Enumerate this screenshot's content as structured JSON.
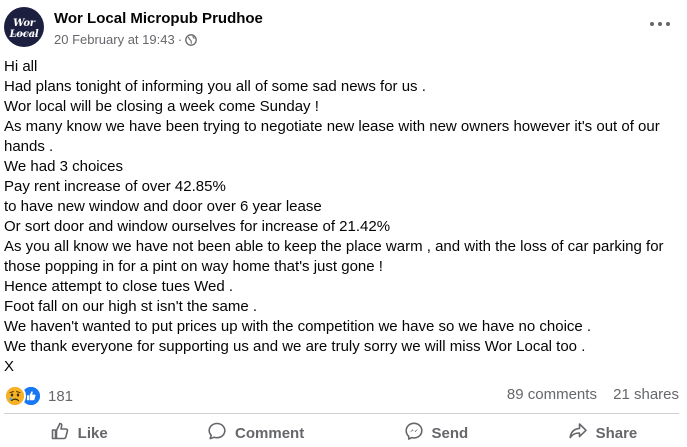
{
  "header": {
    "page_name": "Wor Local Micropub Prudhoe",
    "timestamp": "20 February at 19:43",
    "separator": "·",
    "audience_icon": "globe-icon",
    "avatar_text": "Wor Local",
    "avatar_subtext": "Micropub Prudhoe"
  },
  "post": {
    "lines": [
      "Hi all",
      "Had plans tonight of informing you all of some sad news for us .",
      "Wor local will be closing a week come Sunday !",
      "As many know we have been trying to negotiate new lease with new owners however it's out of our hands .",
      "We had 3 choices",
      "Pay rent increase of over 42.85%",
      "to have new window and door over 6 year lease",
      "Or sort door and window ourselves for increase of 21.42%",
      "As you all know we have not been able to keep the place warm , and with the loss of car parking for those popping in for a pint on way home that's just gone !",
      "Hence attempt to close tues Wed .",
      "Foot fall on our high st isn't the same .",
      "We haven't wanted to put prices up with the competition we have so we have no choice .",
      "We thank everyone for supporting us and we are truly sorry we will miss Wor Local too .",
      "X"
    ]
  },
  "stats": {
    "reaction_icons": [
      "sad-reaction-icon",
      "like-reaction-icon"
    ],
    "reaction_count": "181",
    "comments": "89 comments",
    "shares": "21 shares"
  },
  "actions": {
    "like": "Like",
    "comment": "Comment",
    "send": "Send",
    "share": "Share"
  },
  "colors": {
    "text_primary": "#050505",
    "text_secondary": "#65676b",
    "like_blue": "#1877f2",
    "sad_yellow": "#f7b125",
    "divider": "#ced0d4"
  }
}
